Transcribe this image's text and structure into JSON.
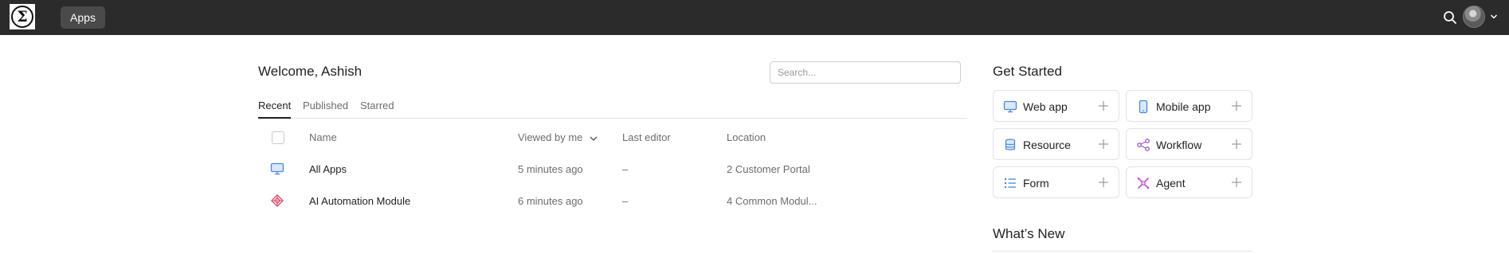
{
  "topbar": {
    "logo_alt": "Σ",
    "apps_label": "Apps"
  },
  "main": {
    "welcome": "Welcome, Ashish",
    "search": {
      "placeholder": "Search..."
    },
    "tabs": [
      {
        "label": "Recent",
        "active": true
      },
      {
        "label": "Published",
        "active": false
      },
      {
        "label": "Starred",
        "active": false
      }
    ],
    "columns": {
      "name": "Name",
      "viewed": "Viewed by me",
      "editor": "Last editor",
      "location": "Location"
    },
    "rows": [
      {
        "icon": "monitor-icon",
        "name": "All Apps",
        "viewed": "5 minutes ago",
        "editor": "–",
        "location": "2 Customer Portal"
      },
      {
        "icon": "module-icon",
        "name": "AI Automation Module",
        "viewed": "6 minutes ago",
        "editor": "–",
        "location": "4 Common Modul..."
      }
    ]
  },
  "get_started": {
    "title": "Get Started",
    "cards": [
      {
        "label": "Web app",
        "icon": "monitor-icon"
      },
      {
        "label": "Mobile app",
        "icon": "mobile-icon"
      },
      {
        "label": "Resource",
        "icon": "database-icon"
      },
      {
        "label": "Workflow",
        "icon": "workflow-icon"
      },
      {
        "label": "Form",
        "icon": "list-icon"
      },
      {
        "label": "Agent",
        "icon": "agent-icon"
      }
    ]
  },
  "whats_new": {
    "title": "What’s New"
  },
  "colors": {
    "topbar": "#2b2b2b",
    "apps_button": "#4a4a4a",
    "accent_blue": "#4a86d9",
    "accent_purple": "#9b59d0",
    "accent_pink": "#d94a8c"
  }
}
